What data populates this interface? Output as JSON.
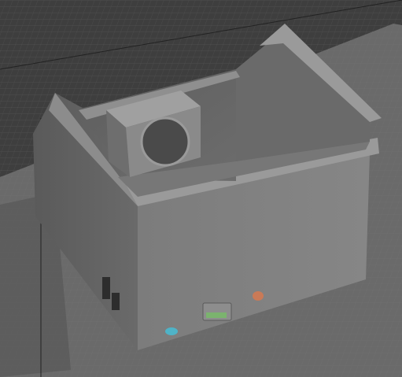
{
  "viewport": {
    "kind": "3d-perspective-viewport",
    "shading": "gray-solid",
    "background": "#3a3a3a",
    "grid_color": "#5a5a5a",
    "ground_plate": "#6c6c6c",
    "model_color": "#8a8a8a"
  },
  "model": {
    "name": "enclosure-box",
    "parts": [
      {
        "name": "fan-mount-bracket",
        "icon": "circle-hole"
      },
      {
        "name": "usb-port-cutout",
        "color": "#7bb36e"
      },
      {
        "name": "round-jack-left",
        "color": "#4fb3c7"
      },
      {
        "name": "round-jack-right",
        "color": "#c97a57"
      }
    ]
  }
}
